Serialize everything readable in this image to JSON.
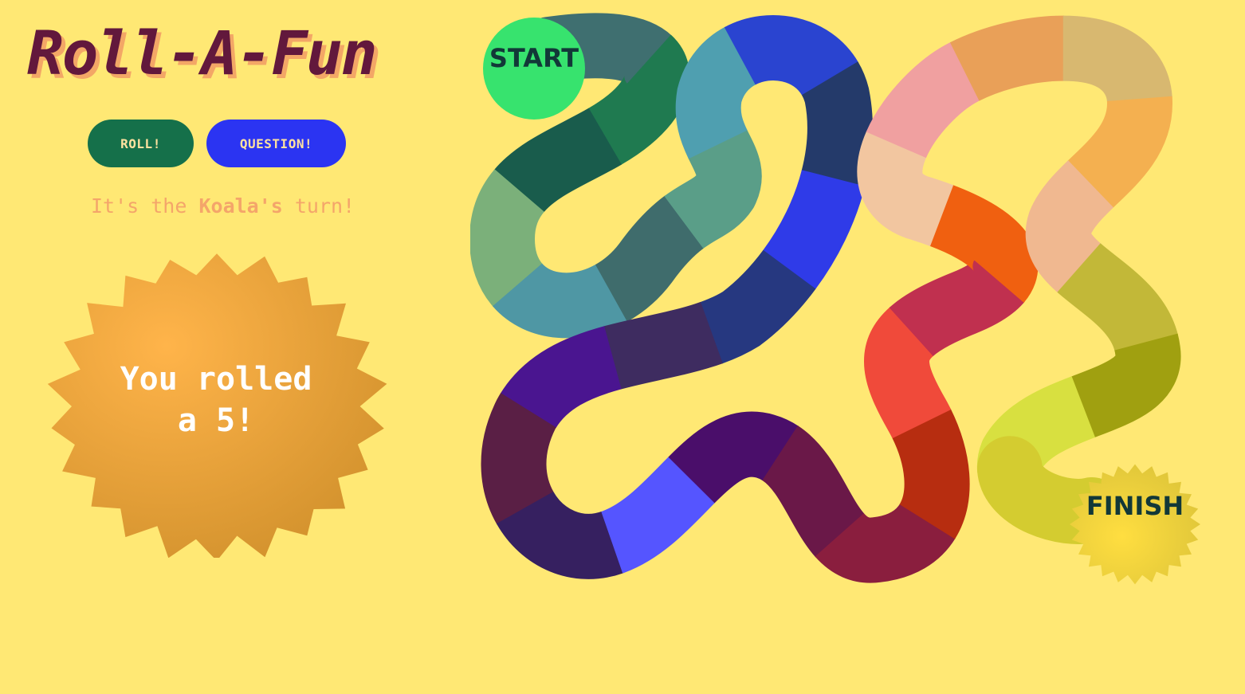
{
  "app": {
    "title": "Roll-A-Fun"
  },
  "controls": {
    "roll_label": "ROLL!",
    "question_label": "QUESTION!"
  },
  "status": {
    "turn_prefix": "It's the ",
    "current_player": "Koala's",
    "turn_suffix": " turn!"
  },
  "dice_result": {
    "message": "You rolled\na 5!",
    "value": 5
  },
  "board": {
    "start_label": "START",
    "finish_label": "FINISH",
    "start_color": "#37e36e",
    "finish_color": "#f9d940",
    "tile_colors": [
      "#3f6f70",
      "#1f7a50",
      "#195c4c",
      "#7bb07a",
      "#4f97a4",
      "#3f6c6c",
      "#5a9e88",
      "#4f9fb0",
      "#2a44d0",
      "#243a6a",
      "#2f3be8",
      "#263880",
      "#3e2c60",
      "#4a1590",
      "#5a1f45",
      "#362060",
      "#5555ff",
      "#4a0e6a",
      "#6a1848",
      "#8a1e3e",
      "#b72d10",
      "#f04a3a",
      "#c0304f",
      "#f06010",
      "#f2c6a0",
      "#f0a0a0",
      "#e9a058",
      "#d8b870",
      "#f4b050",
      "#f0b890",
      "#c2b838",
      "#a0a010",
      "#d8e040",
      "#d4cc30"
    ]
  }
}
